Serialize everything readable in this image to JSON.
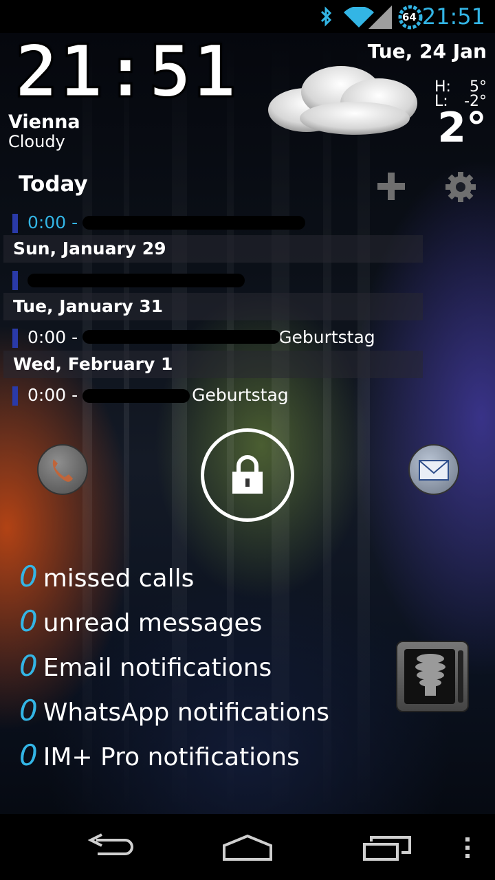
{
  "status_bar": {
    "time": "21:51",
    "battery_level": "64",
    "icons": [
      "bluetooth-icon",
      "wifi-icon",
      "signal-icon",
      "battery-icon"
    ],
    "accent_color": "#33b5e5"
  },
  "clock": {
    "time": "21:51",
    "date": "Tue, 24 Jan"
  },
  "weather": {
    "city": "Vienna",
    "condition": "Cloudy",
    "high_label": "H:",
    "high_value": "5°",
    "low_label": "L:",
    "low_value": "-2°",
    "temperature": "2°",
    "icon": "cloud-icon"
  },
  "calendar": {
    "header": "Today",
    "add_icon": "plus-icon",
    "settings_icon": "gear-icon",
    "entries": [
      {
        "time": "0:00 -",
        "title": ""
      },
      {
        "day": "Sun, January 29"
      },
      {
        "time": "",
        "title": ""
      },
      {
        "day": "Tue, January 31"
      },
      {
        "time": "0:00 -",
        "title": "Geburtstag"
      },
      {
        "day": "Wed, February 1"
      },
      {
        "time": "0:00 -",
        "title": "Geburtstag"
      }
    ]
  },
  "lock": {
    "left_icon": "phone-icon",
    "center_icon": "padlock-icon",
    "right_icon": "envelope-icon"
  },
  "notifications": [
    {
      "count": "0",
      "label": "missed calls"
    },
    {
      "count": "0",
      "label": "unread messages"
    },
    {
      "count": "0",
      "label": "Email notifications"
    },
    {
      "count": "0",
      "label": "WhatsApp notifications"
    },
    {
      "count": "0",
      "label": "IM+ Pro notifications"
    }
  ],
  "flashlight_widget": {
    "icon": "bulb-icon"
  },
  "nav_bar": {
    "back_icon": "back-icon",
    "home_icon": "home-icon",
    "recents_icon": "recents-icon",
    "menu_icon": "overflow-menu-icon"
  }
}
